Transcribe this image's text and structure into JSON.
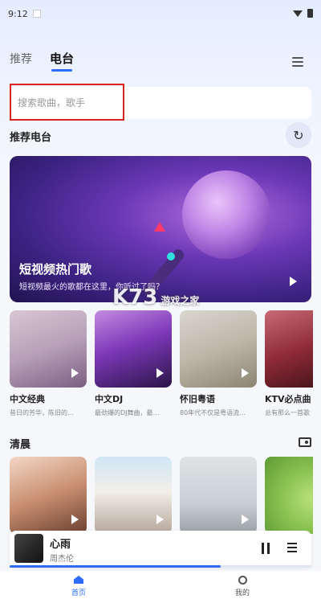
{
  "status": {
    "time": "9:12"
  },
  "tabs": [
    {
      "label": "推荐"
    },
    {
      "label": "电台"
    }
  ],
  "search": {
    "placeholder": "搜索歌曲，歌手"
  },
  "sections": {
    "recommend_title": "推荐电台",
    "morning_title": "清晨"
  },
  "banner": {
    "title": "短视频热门歌",
    "subtitle": "短视频最火的歌都在这里，你听过了吗？"
  },
  "watermark": {
    "text": "K73",
    "sub": "游戏之家"
  },
  "stations": [
    {
      "title": "中文经典",
      "subtitle": "昔日的芳华，陈旧的…"
    },
    {
      "title": "中文DJ",
      "subtitle": "最劲爆的DJ舞曲，最…"
    },
    {
      "title": "怀旧粤语",
      "subtitle": "80年代不仅是粤语流…"
    },
    {
      "title": "KTV必点曲",
      "subtitle": "总有那么一首歌"
    }
  ],
  "player": {
    "song": "心雨",
    "artist": "周杰伦",
    "progress_fraction": 0.7
  },
  "bottom_nav": {
    "home": "首页",
    "me": "我的",
    "peek_left": "DJ"
  },
  "colors": {
    "accent": "#2d6cf6",
    "highlight_box": "#dd2222"
  }
}
